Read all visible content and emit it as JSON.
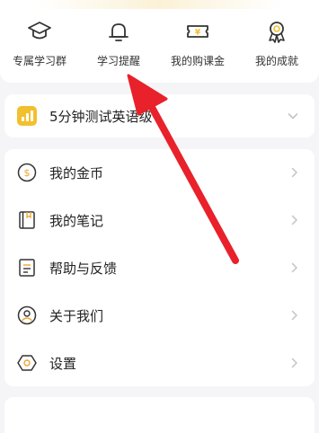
{
  "shortcuts": [
    {
      "label": "专属学习群",
      "icon": "graduation-cap-icon"
    },
    {
      "label": "学习提醒",
      "icon": "bell-icon"
    },
    {
      "label": "我的购课金",
      "icon": "ticket-icon"
    },
    {
      "label": "我的成就",
      "icon": "medal-icon"
    }
  ],
  "level_test": {
    "title": "5分钟测试英语级",
    "icon": "bar-chart-badge-icon",
    "accent": "#f2c02e"
  },
  "menu": [
    {
      "label": "我的金币",
      "icon": "coin-icon"
    },
    {
      "label": "我的笔记",
      "icon": "notebook-icon"
    },
    {
      "label": "帮助与反馈",
      "icon": "feedback-doc-icon"
    },
    {
      "label": "关于我们",
      "icon": "people-icon"
    },
    {
      "label": "设置",
      "icon": "hexagon-settings-icon"
    }
  ],
  "annotation": {
    "color": "#e8212b",
    "icon": "red-arrow-icon"
  }
}
